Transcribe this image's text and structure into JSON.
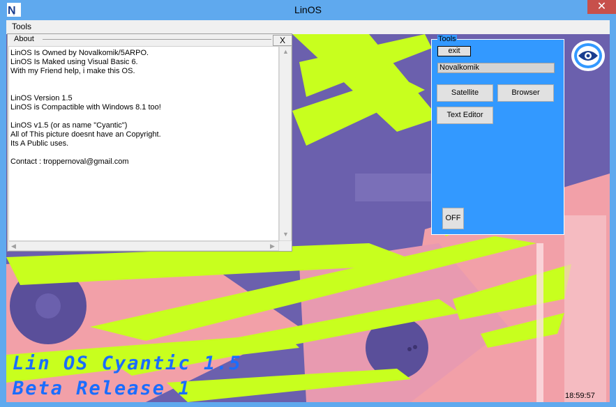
{
  "window": {
    "title": "LinOS",
    "close_glyph": "✕",
    "app_icon": "linos-app-icon"
  },
  "menu": {
    "tools_label": "Tools"
  },
  "about": {
    "title": "About",
    "close_label": "X",
    "lines": [
      "LinOS Is Owned by Novalkomik/5ARPO.",
      "LinOS Is Maked using Visual Basic 6.",
      "With my Friend help, i make this OS.",
      "",
      "",
      "LinOS Version 1.5",
      "LinOS is Compactible with Windows 8.1 too!",
      "",
      "LinOS v1.5 (or as name \"Cyantic\")",
      "All of This picture doesnt have an Copyright.",
      "Its A Public uses.",
      "",
      "Contact : troppernoval@gmail.com"
    ]
  },
  "tools": {
    "title": "Tools",
    "exit_label": "exit",
    "username": "Novalkomik",
    "satellite_label": "Satellite",
    "browser_label": "Browser",
    "text_editor_label": "Text Editor",
    "off_label": "OFF"
  },
  "branding": {
    "line1": "Lin OS Cyantic 1.5",
    "line2": "Beta Release 1"
  },
  "clock": "18:59:57",
  "colors": {
    "titlebar": "#5fa9ee",
    "tools_panel": "#3399ff",
    "brand_text": "#1a6dff",
    "accent_lime": "#c8ff1e"
  }
}
